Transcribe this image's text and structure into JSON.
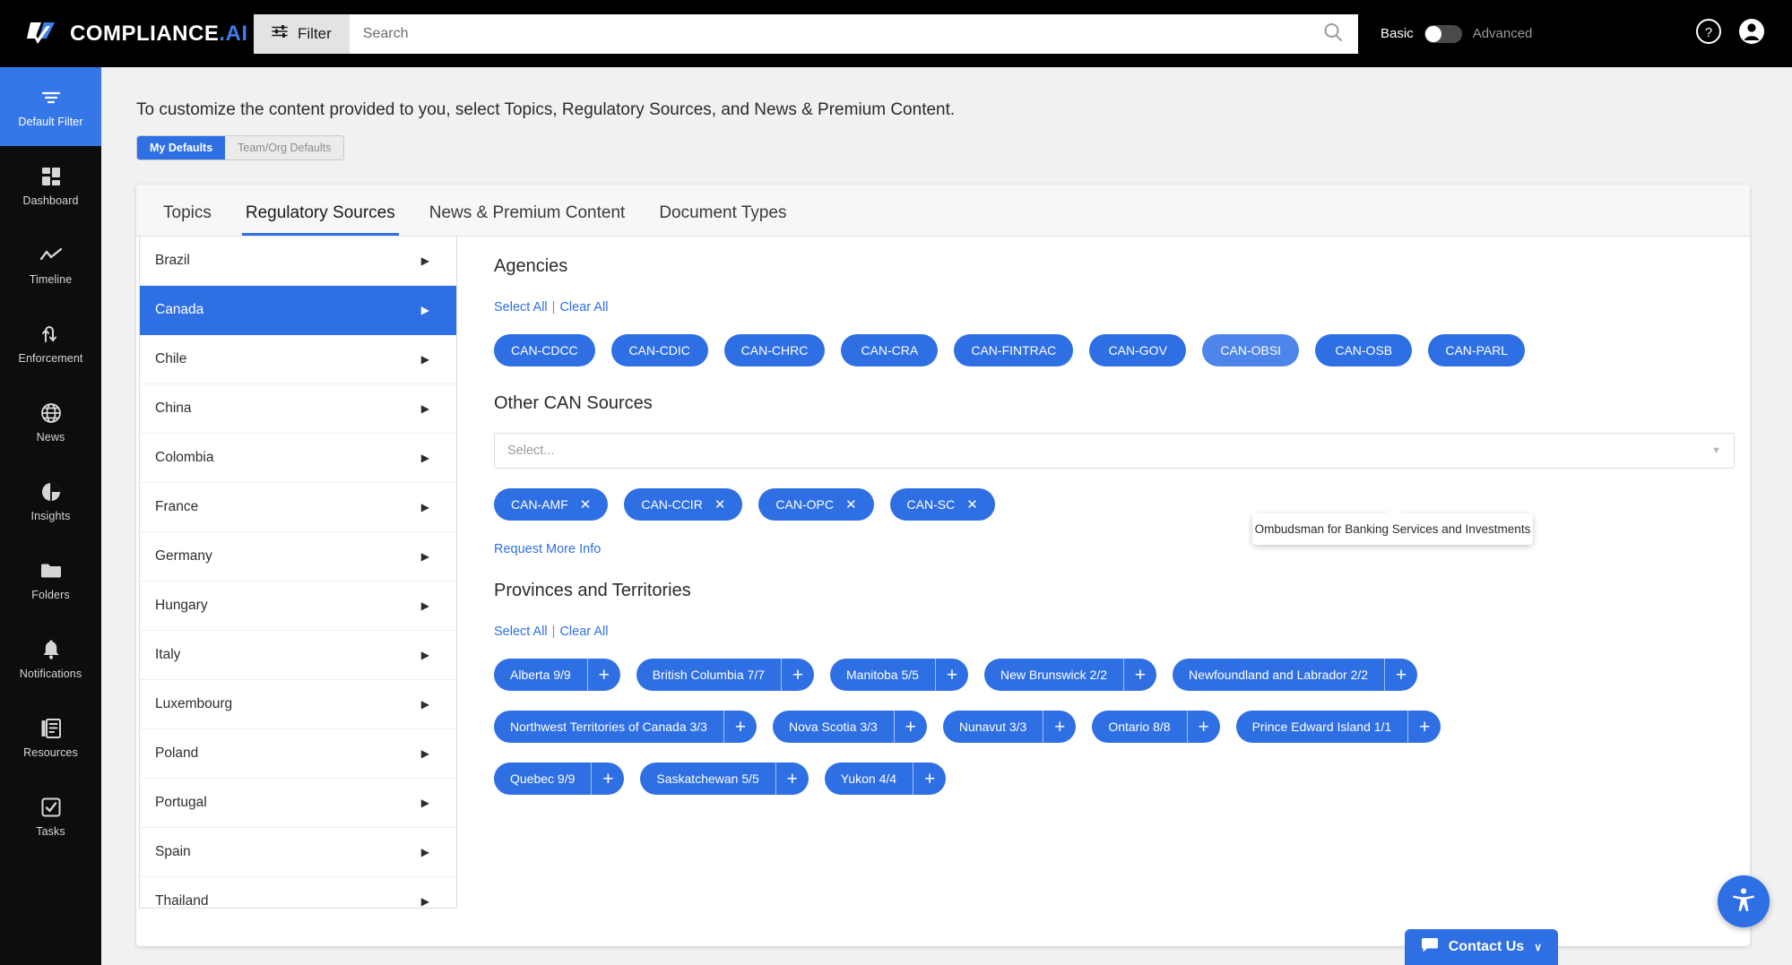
{
  "topbar": {
    "brand_name": "COMPLIANCE",
    "brand_suffix": ".AI",
    "filter_label": "Filter",
    "search_placeholder": "Search",
    "search_value": "",
    "mode_basic": "Basic",
    "mode_advanced": "Advanced",
    "help_icon": "help-circle-icon",
    "account_icon": "account-circle-icon",
    "search_icon": "search-icon",
    "filter_icon": "filter-sliders-icon"
  },
  "leftnav": {
    "items": [
      {
        "label": "Default Filter",
        "icon": "filter-lines-icon",
        "active": true
      },
      {
        "label": "Dashboard",
        "icon": "dashboard-grid-icon",
        "active": false
      },
      {
        "label": "Timeline",
        "icon": "timeline-chart-icon",
        "active": false
      },
      {
        "label": "Enforcement",
        "icon": "enforcement-arrows-icon",
        "active": false
      },
      {
        "label": "News",
        "icon": "globe-icon",
        "active": false
      },
      {
        "label": "Insights",
        "icon": "pie-chart-icon",
        "active": false
      },
      {
        "label": "Folders",
        "icon": "folder-icon",
        "active": false
      },
      {
        "label": "Notifications",
        "icon": "bell-icon",
        "active": false
      },
      {
        "label": "Resources",
        "icon": "book-icon",
        "active": false
      },
      {
        "label": "Tasks",
        "icon": "checkbox-icon",
        "active": false
      }
    ]
  },
  "main": {
    "intro": "To customize the content provided to you, select Topics, Regulatory Sources, and News & Premium Content.",
    "segmented": [
      {
        "label": "My Defaults",
        "active": true
      },
      {
        "label": "Team/Org Defaults",
        "active": false
      }
    ],
    "tabs": [
      {
        "label": "Topics",
        "active": false
      },
      {
        "label": "Regulatory Sources",
        "active": true
      },
      {
        "label": "News & Premium Content",
        "active": false
      },
      {
        "label": "Document Types",
        "active": false
      }
    ],
    "countries": [
      {
        "label": "Brazil",
        "selected": false
      },
      {
        "label": "Canada",
        "selected": true
      },
      {
        "label": "Chile",
        "selected": false
      },
      {
        "label": "China",
        "selected": false
      },
      {
        "label": "Colombia",
        "selected": false
      },
      {
        "label": "France",
        "selected": false
      },
      {
        "label": "Germany",
        "selected": false
      },
      {
        "label": "Hungary",
        "selected": false
      },
      {
        "label": "Italy",
        "selected": false
      },
      {
        "label": "Luxembourg",
        "selected": false
      },
      {
        "label": "Poland",
        "selected": false
      },
      {
        "label": "Portugal",
        "selected": false
      },
      {
        "label": "Spain",
        "selected": false
      },
      {
        "label": "Thailand",
        "selected": false
      }
    ],
    "agencies": {
      "title": "Agencies",
      "select_all": "Select All",
      "clear_all": "Clear All",
      "separator": "|",
      "chips": [
        {
          "label": "CAN-CDCC",
          "hover": false
        },
        {
          "label": "CAN-CDIC",
          "hover": false
        },
        {
          "label": "CAN-CHRC",
          "hover": false
        },
        {
          "label": "CAN-CRA",
          "hover": false
        },
        {
          "label": "CAN-FINTRAC",
          "hover": false
        },
        {
          "label": "CAN-GOV",
          "hover": false
        },
        {
          "label": "CAN-OBSI",
          "hover": true
        },
        {
          "label": "CAN-OSB",
          "hover": false
        },
        {
          "label": "CAN-PARL",
          "hover": false
        }
      ]
    },
    "other_sources": {
      "title": "Other CAN Sources",
      "select_placeholder": "Select...",
      "chips": [
        {
          "label": "CAN-AMF",
          "remove": "✕"
        },
        {
          "label": "CAN-CCIR",
          "remove": "✕"
        },
        {
          "label": "CAN-OPC",
          "remove": "✕"
        },
        {
          "label": "CAN-SC",
          "remove": "✕"
        }
      ],
      "request_more_info": "Request More Info"
    },
    "tooltip": {
      "text": "Ombudsman for Banking Services and Investments"
    },
    "provinces": {
      "title": "Provinces and Territories",
      "select_all": "Select All",
      "clear_all": "Clear All",
      "separator": "|",
      "rows": [
        [
          {
            "label": "Alberta 9/9",
            "plus": "+"
          },
          {
            "label": "British Columbia 7/7",
            "plus": "+"
          },
          {
            "label": "Manitoba 5/5",
            "plus": "+"
          },
          {
            "label": "New Brunswick 2/2",
            "plus": "+"
          },
          {
            "label": "Newfoundland and Labrador 2/2",
            "plus": "+"
          }
        ],
        [
          {
            "label": "Northwest Territories of Canada 3/3",
            "plus": "+"
          },
          {
            "label": "Nova Scotia 3/3",
            "plus": "+"
          },
          {
            "label": "Nunavut 3/3",
            "plus": "+"
          },
          {
            "label": "Ontario 8/8",
            "plus": "+"
          },
          {
            "label": "Prince Edward Island 1/1",
            "plus": "+"
          }
        ],
        [
          {
            "label": "Quebec 9/9",
            "plus": "+"
          },
          {
            "label": "Saskatchewan 5/5",
            "plus": "+"
          },
          {
            "label": "Yukon 4/4",
            "plus": "+"
          }
        ]
      ]
    }
  },
  "floating": {
    "contact_us": "Contact Us",
    "contact_chevron": "∨",
    "accessibility_icon": "accessibility-person-icon",
    "chat_icon": "chat-bubble-icon"
  },
  "colors": {
    "accent": "#2f6fe4",
    "nav_active": "#3577e8",
    "topbar_bg": "#000000",
    "page_bg": "#f1f1f1"
  }
}
